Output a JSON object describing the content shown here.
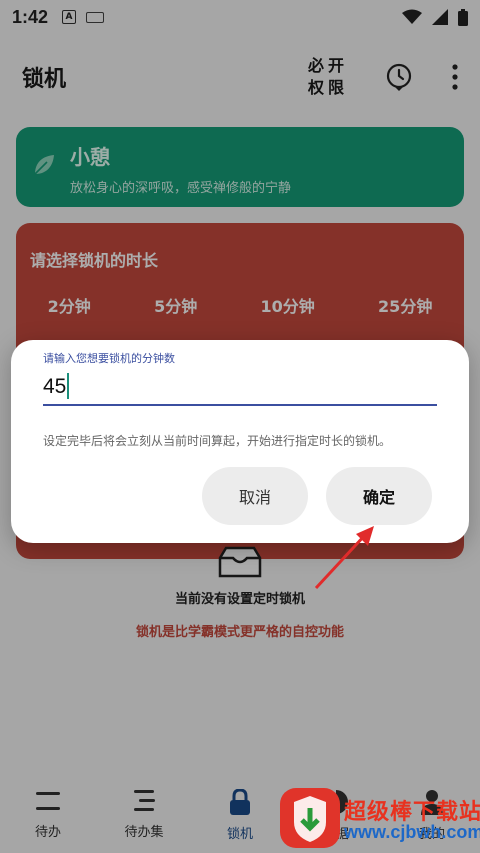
{
  "status_bar": {
    "time": "1:42",
    "notif_a": "A",
    "colors": {
      "text": "#222222"
    }
  },
  "app_bar": {
    "title": "锁机",
    "permissions_line1": "必开",
    "permissions_line2": "权限",
    "clock_icon": "clock-icon",
    "menu_icon": "more-vert-icon"
  },
  "break_card": {
    "title": "小憩",
    "description": "放松身心的深呼吸，感受禅修般的宁静",
    "color": "#159c78",
    "icon": "leaf-icon"
  },
  "duration_card": {
    "title": "请选择锁机的时长",
    "options": [
      "2分钟",
      "5分钟",
      "10分钟",
      "25分钟"
    ],
    "color": "#c4493d"
  },
  "empty_state": {
    "text": "当前没有设置定时锁机",
    "lock_description": "锁机是比学霸模式更严格的自控功能",
    "icon": "empty-box-icon"
  },
  "dialog": {
    "input_label": "请输入您想要锁机的分钟数",
    "input_value": "45",
    "hint": "设定完毕后将会立刻从当前时间算起，开始进行指定时长的锁机。",
    "cancel_label": "取消",
    "confirm_label": "确定"
  },
  "bottom_nav": {
    "items": [
      {
        "label": "待办",
        "icon": "todo-icon"
      },
      {
        "label": "待办集",
        "icon": "todo-list-icon"
      },
      {
        "label": "锁机",
        "icon": "lock-icon",
        "active": true
      },
      {
        "label": "数据",
        "icon": "chart-icon"
      },
      {
        "label": "我的",
        "icon": "profile-icon"
      }
    ]
  },
  "watermark": {
    "title": "超级棒下载站",
    "url": "www.cjbwh.com"
  }
}
